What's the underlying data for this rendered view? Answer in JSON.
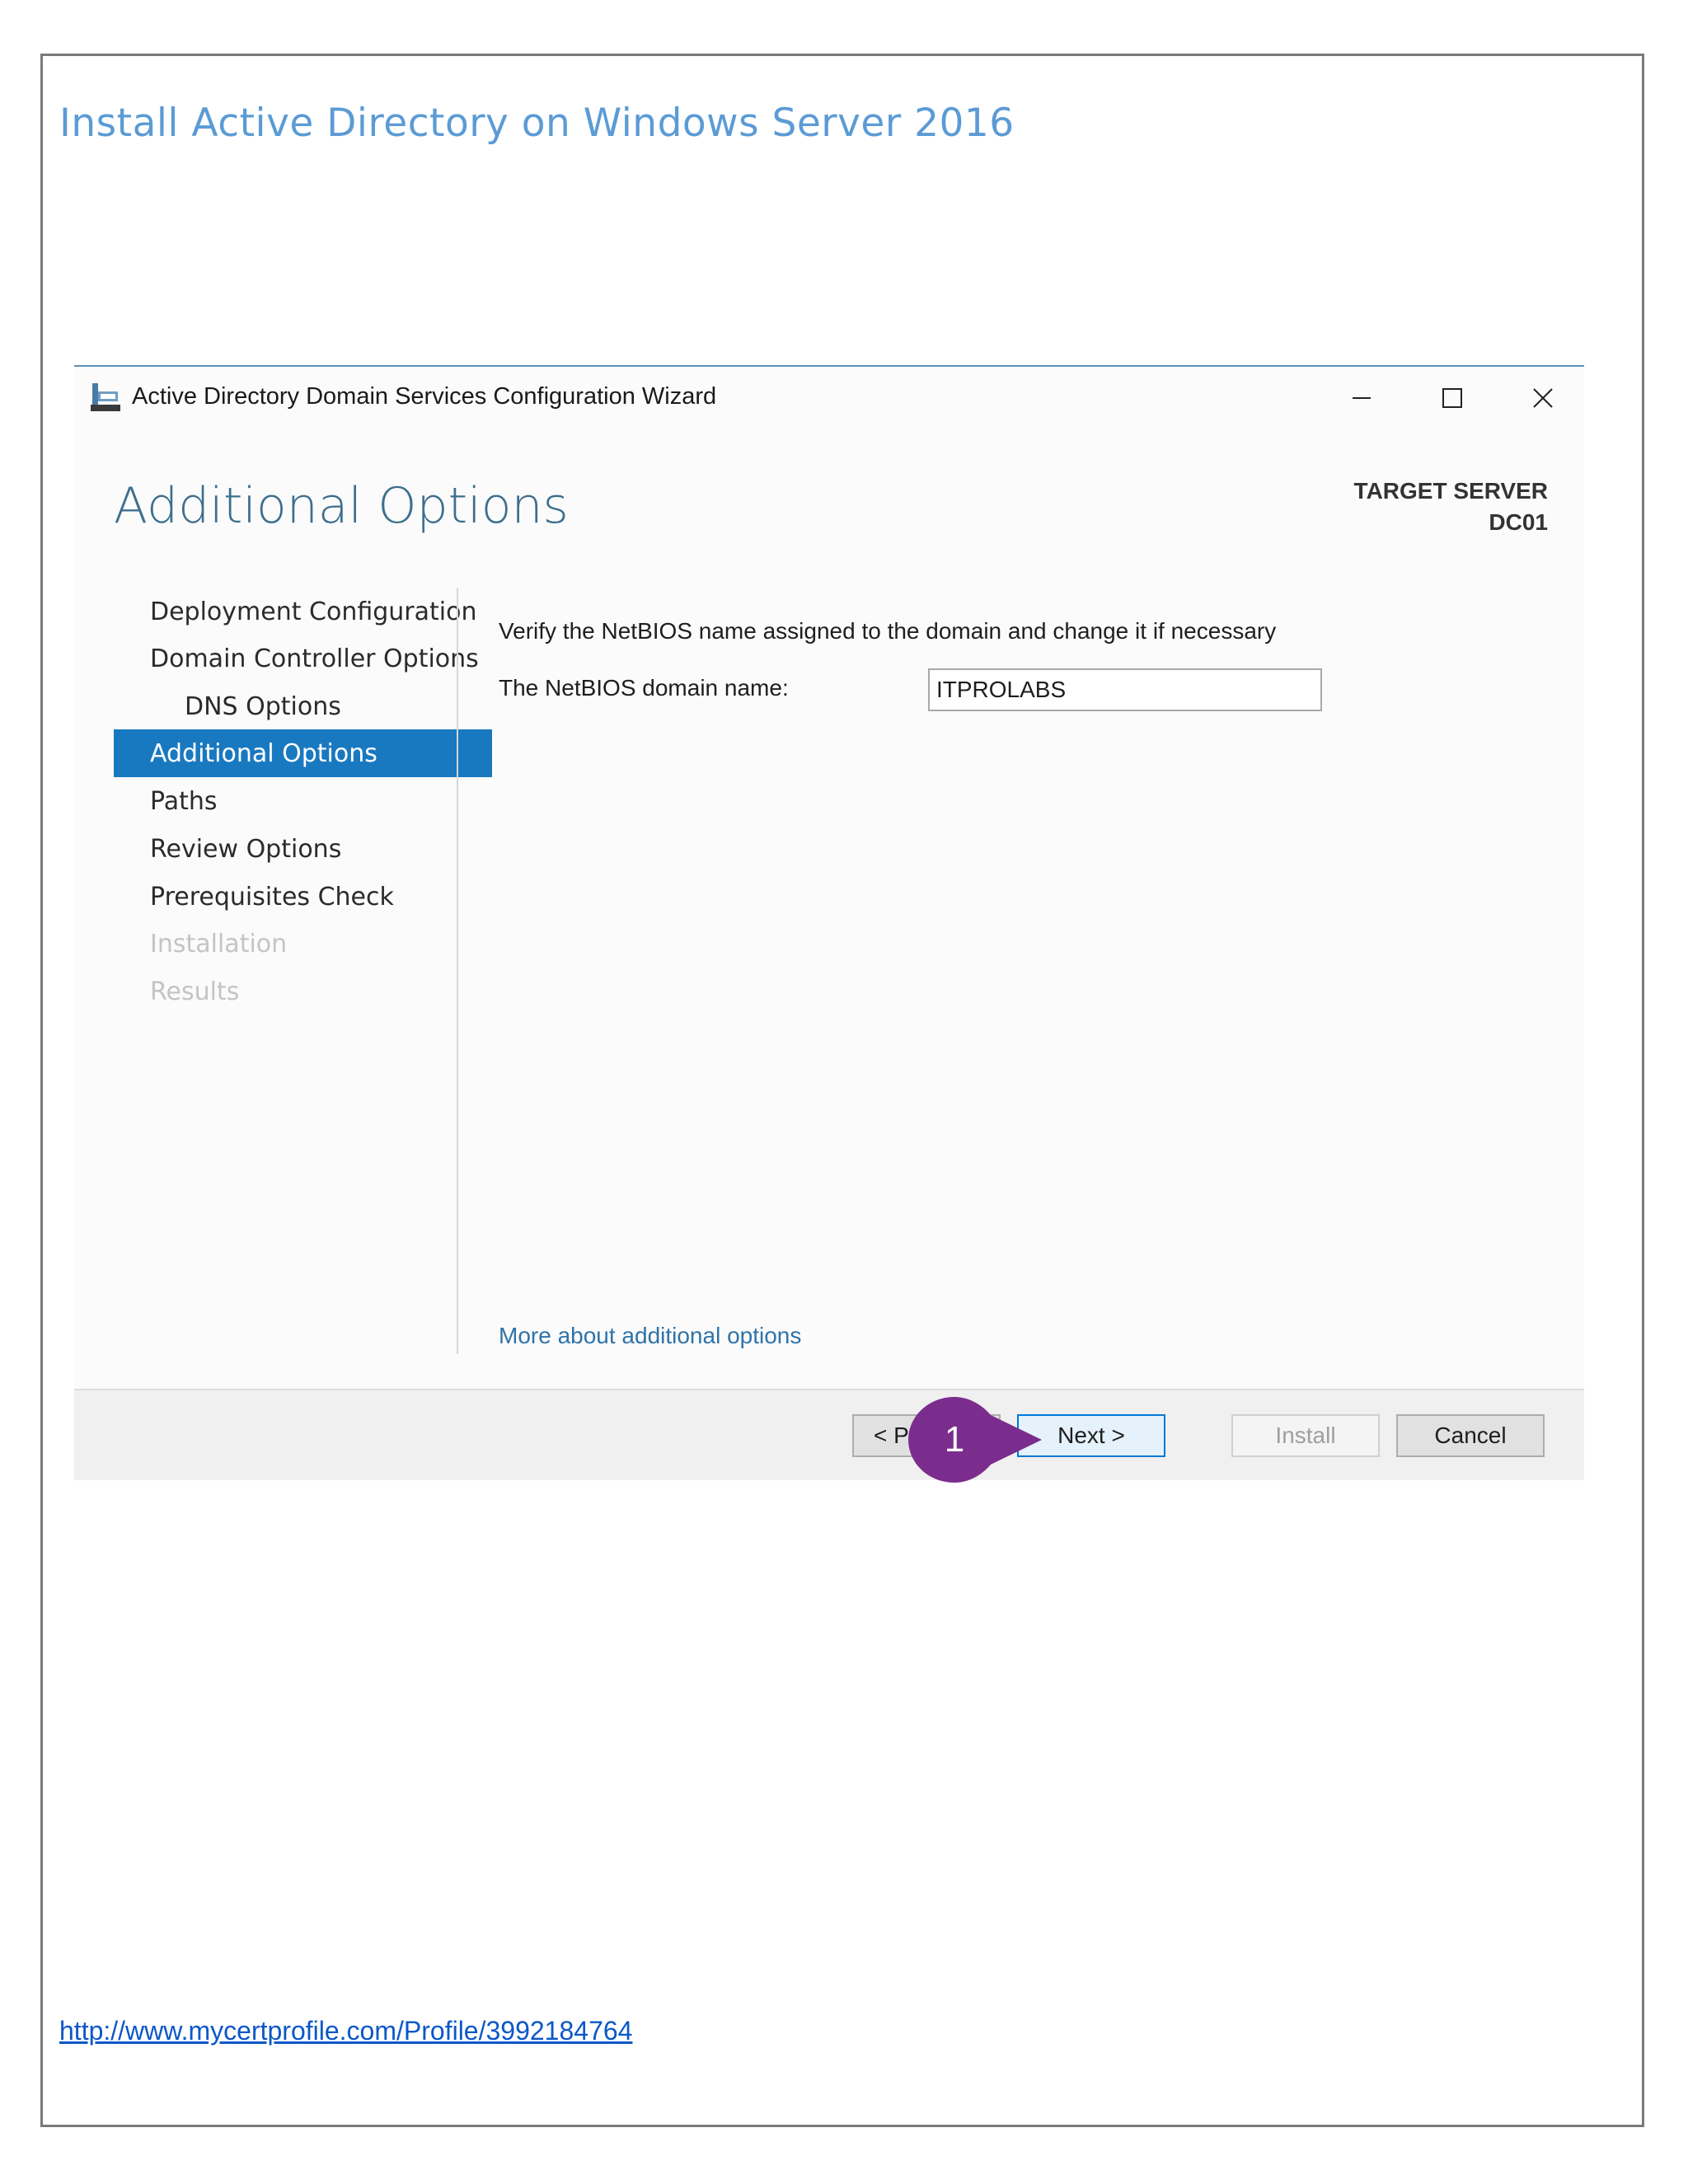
{
  "document": {
    "title": "Install Active Directory on Windows Server 2016",
    "footer_link": "http://www.mycertprofile.com/Profile/3992184764"
  },
  "window": {
    "title": "Active Directory Domain Services Configuration Wizard",
    "min_glyph": "–",
    "max_glyph": "☐",
    "close_glyph": "✕"
  },
  "page": {
    "heading": "Additional Options",
    "target_server_label": "TARGET SERVER",
    "target_server_name": "DC01"
  },
  "nav": {
    "items": [
      {
        "label": "Deployment Configuration",
        "state": "normal"
      },
      {
        "label": "Domain Controller Options",
        "state": "normal"
      },
      {
        "label": "DNS Options",
        "state": "indent"
      },
      {
        "label": "Additional Options",
        "state": "active"
      },
      {
        "label": "Paths",
        "state": "normal"
      },
      {
        "label": "Review Options",
        "state": "normal"
      },
      {
        "label": "Prerequisites Check",
        "state": "normal"
      },
      {
        "label": "Installation",
        "state": "disabled"
      },
      {
        "label": "Results",
        "state": "disabled"
      }
    ]
  },
  "content": {
    "instruction": "Verify the NetBIOS name assigned to the domain and change it if necessary",
    "netbios_label": "The NetBIOS domain name:",
    "netbios_value": "ITPROLABS",
    "more_link": "More about additional options"
  },
  "buttons": {
    "previous": "< P",
    "next": "Next >",
    "install": "Install",
    "cancel": "Cancel"
  },
  "callout": {
    "number": "1",
    "color": "#7b2d8e"
  }
}
